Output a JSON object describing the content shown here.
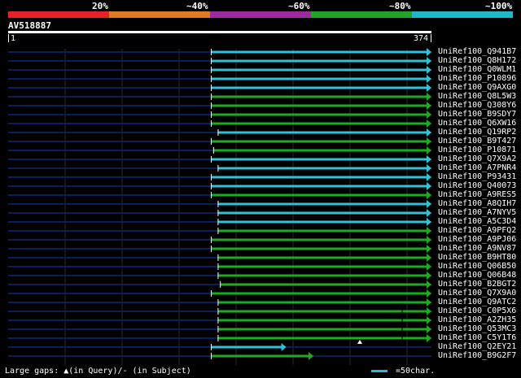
{
  "legend": {
    "labels": [
      "20%",
      "~40%",
      "~60%",
      "~80%",
      "~100%"
    ],
    "colors": [
      "#e8202a",
      "#e07a1e",
      "#9b2a9e",
      "#23a326",
      "#20b8c8"
    ]
  },
  "query": {
    "id": "AV518887",
    "start": "1",
    "end": "374",
    "length": 374
  },
  "hits": [
    {
      "name": "UniRef100_Q941B7",
      "start": 180,
      "end": 374,
      "color": "#2fc2d9",
      "gap": false
    },
    {
      "name": "UniRef100_Q8H172",
      "start": 180,
      "end": 374,
      "color": "#2fc2d9",
      "gap": false
    },
    {
      "name": "UniRef100_Q0WLM1",
      "start": 180,
      "end": 374,
      "color": "#2fc2d9",
      "gap": false
    },
    {
      "name": "UniRef100_P10896",
      "start": 180,
      "end": 374,
      "color": "#2fc2d9",
      "gap": false
    },
    {
      "name": "UniRef100_Q9AXG0",
      "start": 180,
      "end": 374,
      "color": "#2fc2d9",
      "gap": false
    },
    {
      "name": "UniRef100_Q8L5W3",
      "start": 180,
      "end": 374,
      "color": "#1faa22",
      "gap": false
    },
    {
      "name": "UniRef100_Q308Y6",
      "start": 180,
      "end": 374,
      "color": "#1faa22",
      "gap": false
    },
    {
      "name": "UniRef100_B9SDY7",
      "start": 180,
      "end": 374,
      "color": "#1faa22",
      "gap": false
    },
    {
      "name": "UniRef100_Q6XW16",
      "start": 180,
      "end": 374,
      "color": "#1faa22",
      "gap": false
    },
    {
      "name": "UniRef100_Q19RP2",
      "start": 186,
      "end": 374,
      "color": "#2fc2d9",
      "gap": false
    },
    {
      "name": "UniRef100_B9T427",
      "start": 180,
      "end": 374,
      "color": "#1faa22",
      "gap": false
    },
    {
      "name": "UniRef100_P10871",
      "start": 182,
      "end": 374,
      "color": "#1faa22",
      "gap": false
    },
    {
      "name": "UniRef100_Q7X9A2",
      "start": 180,
      "end": 374,
      "color": "#2fc2d9",
      "gap": false
    },
    {
      "name": "UniRef100_A7PNR4",
      "start": 186,
      "end": 374,
      "color": "#2fc2d9",
      "gap": false
    },
    {
      "name": "UniRef100_P93431",
      "start": 180,
      "end": 374,
      "color": "#2fc2d9",
      "gap": false
    },
    {
      "name": "UniRef100_Q40073",
      "start": 180,
      "end": 374,
      "color": "#2fc2d9",
      "gap": false
    },
    {
      "name": "UniRef100_A9RES5",
      "start": 180,
      "end": 374,
      "color": "#1faa22",
      "gap": false
    },
    {
      "name": "UniRef100_A8QIH7",
      "start": 186,
      "end": 374,
      "color": "#2fc2d9",
      "gap": false
    },
    {
      "name": "UniRef100_A7NYV5",
      "start": 186,
      "end": 374,
      "color": "#2fc2d9",
      "gap": false
    },
    {
      "name": "UniRef100_A5C3D4",
      "start": 186,
      "end": 374,
      "color": "#2fc2d9",
      "gap": false
    },
    {
      "name": "UniRef100_A9PFQ2",
      "start": 186,
      "end": 374,
      "color": "#1faa22",
      "gap": false
    },
    {
      "name": "UniRef100_A9PJ06",
      "start": 180,
      "end": 374,
      "color": "#1faa22",
      "gap": false
    },
    {
      "name": "UniRef100_A9NV87",
      "start": 180,
      "end": 374,
      "color": "#1faa22",
      "gap": false
    },
    {
      "name": "UniRef100_B9HT80",
      "start": 186,
      "end": 374,
      "color": "#1faa22",
      "gap": false
    },
    {
      "name": "UniRef100_Q06B50",
      "start": 186,
      "end": 374,
      "color": "#1faa22",
      "gap": false
    },
    {
      "name": "UniRef100_Q06B48",
      "start": 186,
      "end": 374,
      "color": "#1faa22",
      "gap": false
    },
    {
      "name": "UniRef100_B2BGT2",
      "start": 188,
      "end": 374,
      "color": "#1faa22",
      "gap": false
    },
    {
      "name": "UniRef100_Q7X9A0",
      "start": 180,
      "end": 374,
      "color": "#1faa22",
      "gap": false
    },
    {
      "name": "UniRef100_Q9ATC2",
      "start": 186,
      "end": 374,
      "color": "#1faa22",
      "gap": false
    },
    {
      "name": "UniRef100_C0P5X6",
      "start": 186,
      "end": 374,
      "color": "#1faa22",
      "gap": true
    },
    {
      "name": "UniRef100_A2ZH35",
      "start": 186,
      "end": 374,
      "color": "#1faa22",
      "gap": true
    },
    {
      "name": "UniRef100_Q53MC3",
      "start": 186,
      "end": 374,
      "color": "#1faa22",
      "gap": true
    },
    {
      "name": "UniRef100_C5Y1T6",
      "start": 186,
      "end": 374,
      "color": "#1faa22",
      "gap": true
    },
    {
      "name": "UniRef100_Q2EY21",
      "start": 180,
      "end": 246,
      "color": "#2fc2d9",
      "gap": false
    },
    {
      "name": "UniRef100_B9G2F7",
      "start": 180,
      "end": 270,
      "color": "#1faa22",
      "gap": false
    }
  ],
  "footer": {
    "gaps_text": "Large gaps: ▲(in Query)/- (in Subject)",
    "scale_text": "=50char."
  },
  "colors": {
    "background": "#000000",
    "track": "#0a1e5a",
    "grid": "#2a2a2a"
  }
}
